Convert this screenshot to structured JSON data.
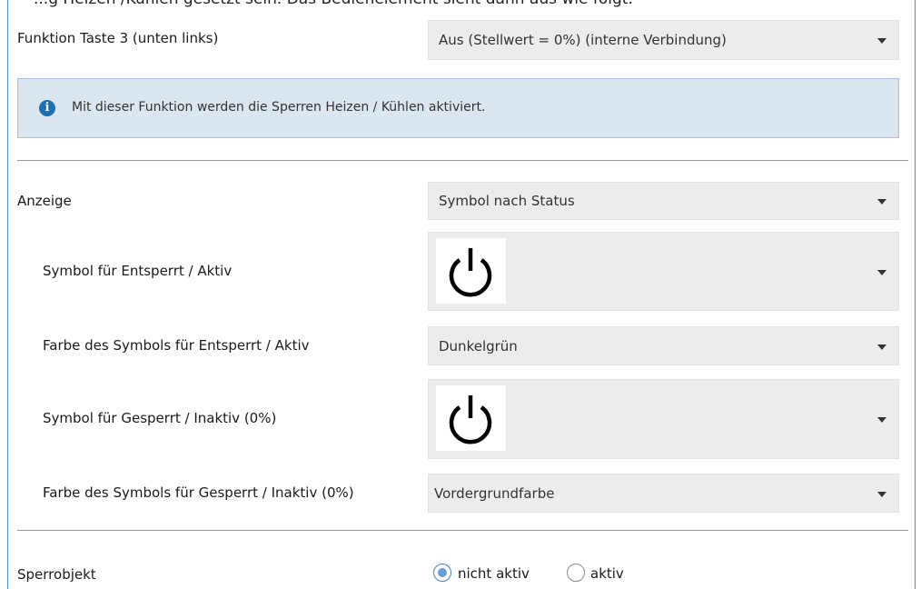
{
  "cut_title": "...g Heizen /Kühlen gesetzt sein. Das Bedienelement sieht dann aus wie folgt:",
  "funktion": {
    "label": "Funktion Taste 3 (unten links)",
    "value": "Aus (Stellwert = 0%) (interne Verbindung)"
  },
  "info": {
    "icon": "info-icon",
    "text": "Mit dieser Funktion werden die Sperren Heizen / Kühlen aktiviert."
  },
  "anzeige": {
    "label": "Anzeige",
    "value": "Symbol nach Status"
  },
  "symbol_aktiv": {
    "label": "Symbol für Entsperrt / Aktiv",
    "icon": "power-icon"
  },
  "farbe_aktiv": {
    "label": "Farbe des Symbols für Entsperrt / Aktiv",
    "value": "Dunkelgrün"
  },
  "symbol_inaktiv": {
    "label": "Symbol für Gesperrt / Inaktiv (0%)",
    "icon": "power-icon"
  },
  "farbe_inaktiv": {
    "label": "Farbe des Symbols für Gesperrt / Inaktiv (0%)",
    "value": "Vordergrundfarbe"
  },
  "sperrobjekt": {
    "label": "Sperrobjekt",
    "options": [
      "nicht aktiv",
      "aktiv"
    ],
    "selected": "nicht aktiv"
  },
  "colors": {
    "accent": "#1f6fb5",
    "info_bg": "#dce6f1",
    "select_bg": "#ececec",
    "frame_border": "#4a8fd0"
  }
}
